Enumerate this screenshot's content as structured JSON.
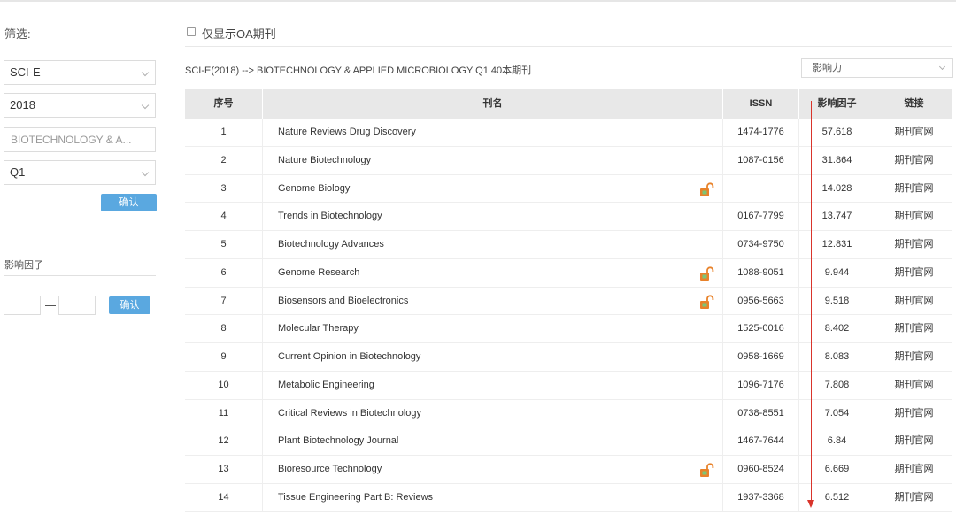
{
  "sidebar": {
    "filter_label": "筛选:",
    "database_select": "SCI-E",
    "year_select": "2018",
    "category_input": "BIOTECHNOLOGY & A...",
    "quartile_select": "Q1",
    "confirm_label": "确认",
    "impact_factor_label": "影响因子",
    "if_min": "",
    "if_max": "",
    "if_confirm_label": "确认"
  },
  "main": {
    "oa_only_label": "仅显示OA期刊",
    "breadcrumb": "SCI-E(2018) --> BIOTECHNOLOGY & APPLIED MICROBIOLOGY  Q1  40本期刊",
    "sort_select": "影响力",
    "table": {
      "headers": {
        "no": "序号",
        "name": "刊名",
        "issn": "ISSN",
        "if": "影响因子",
        "link": "链接"
      },
      "rows": [
        {
          "no": "1",
          "name": "Nature Reviews Drug Discovery",
          "issn": "1474-1776",
          "if": "57.618",
          "link": "期刊官网",
          "oa": false
        },
        {
          "no": "2",
          "name": "Nature Biotechnology",
          "issn": "1087-0156",
          "if": "31.864",
          "link": "期刊官网",
          "oa": false
        },
        {
          "no": "3",
          "name": "Genome Biology",
          "issn": "",
          "if": "14.028",
          "link": "期刊官网",
          "oa": true
        },
        {
          "no": "4",
          "name": "Trends in Biotechnology",
          "issn": "0167-7799",
          "if": "13.747",
          "link": "期刊官网",
          "oa": false
        },
        {
          "no": "5",
          "name": "Biotechnology Advances",
          "issn": "0734-9750",
          "if": "12.831",
          "link": "期刊官网",
          "oa": false
        },
        {
          "no": "6",
          "name": "Genome Research",
          "issn": "1088-9051",
          "if": "9.944",
          "link": "期刊官网",
          "oa": true
        },
        {
          "no": "7",
          "name": "Biosensors and Bioelectronics",
          "issn": "0956-5663",
          "if": "9.518",
          "link": "期刊官网",
          "oa": true
        },
        {
          "no": "8",
          "name": "Molecular Therapy",
          "issn": "1525-0016",
          "if": "8.402",
          "link": "期刊官网",
          "oa": false
        },
        {
          "no": "9",
          "name": "Current Opinion in Biotechnology",
          "issn": "0958-1669",
          "if": "8.083",
          "link": "期刊官网",
          "oa": false
        },
        {
          "no": "10",
          "name": "Metabolic Engineering",
          "issn": "1096-7176",
          "if": "7.808",
          "link": "期刊官网",
          "oa": false
        },
        {
          "no": "11",
          "name": "Critical Reviews in Biotechnology",
          "issn": "0738-8551",
          "if": "7.054",
          "link": "期刊官网",
          "oa": false
        },
        {
          "no": "12",
          "name": "Plant Biotechnology Journal",
          "issn": "1467-7644",
          "if": "6.84",
          "link": "期刊官网",
          "oa": false
        },
        {
          "no": "13",
          "name": "Bioresource Technology",
          "issn": "0960-8524",
          "if": "6.669",
          "link": "期刊官网",
          "oa": true
        },
        {
          "no": "14",
          "name": "Tissue Engineering Part B: Reviews",
          "issn": "1937-3368",
          "if": "6.512",
          "link": "期刊官网",
          "oa": false
        }
      ]
    }
  },
  "icons": {
    "oa_icon": "open-lock-icon",
    "select_icon": "chevron-down-icon",
    "annotation": "down-arrow-icon"
  },
  "colors": {
    "accent": "#5aa8e0",
    "lock_orange": "#e8822a",
    "lock_green": "#7cc576",
    "arrow_red": "#d9342b",
    "header_bg": "#e8e8e8"
  }
}
